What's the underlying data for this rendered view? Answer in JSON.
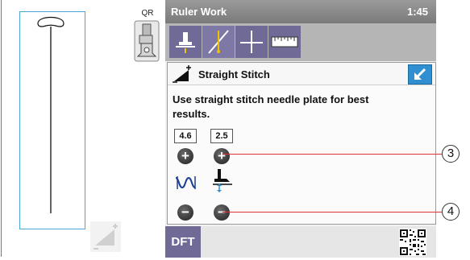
{
  "left_panel": {
    "foot_label": "QR"
  },
  "header": {
    "title": "Ruler Work",
    "time": "1:45"
  },
  "toolbar": {
    "tabs": [
      "ruler-work-tab",
      "stitch-tab",
      "alignment-tab",
      "ruler-tab"
    ]
  },
  "stitch": {
    "name": "Straight Stitch",
    "message": "Use straight stitch needle plate for best results.",
    "width_value": "4.6",
    "length_value": "2.5",
    "plus_symbol": "+",
    "minus_symbol": "−"
  },
  "bottom": {
    "dft_label": "DFT"
  },
  "callouts": [
    "3",
    "4"
  ],
  "colors": {
    "accent_blue": "#2f8fd0",
    "tab_purple": "#6f6a96",
    "callout_red": "#e0303a"
  }
}
